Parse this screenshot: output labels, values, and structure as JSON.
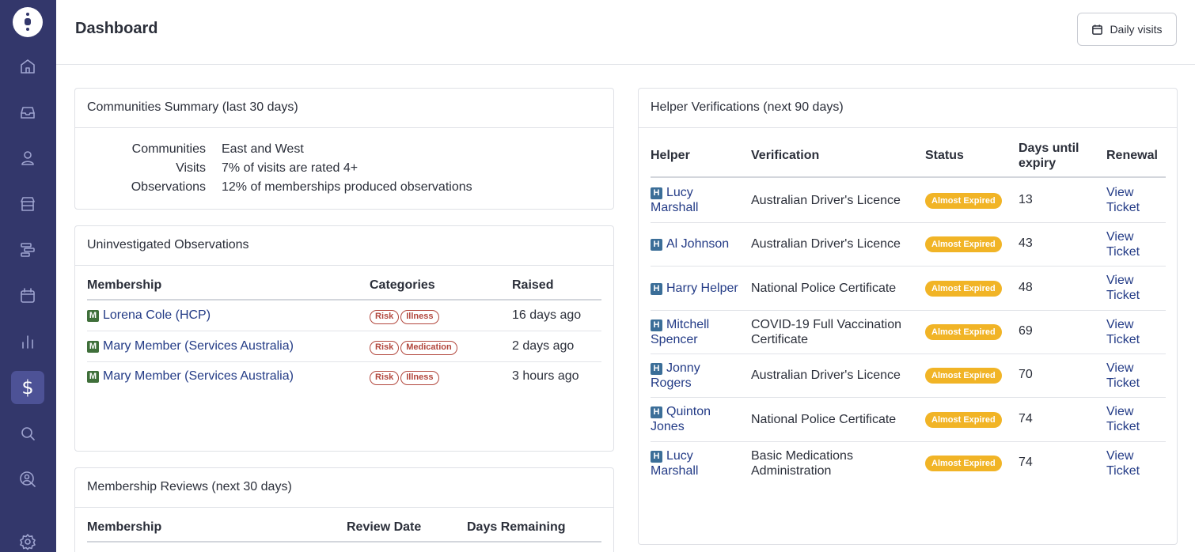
{
  "page": {
    "title": "Dashboard"
  },
  "header": {
    "daily_visits_label": "Daily visits"
  },
  "communities_summary": {
    "title": "Communities Summary (last 30 days)",
    "rows": [
      {
        "label": "Communities",
        "value": "East and West"
      },
      {
        "label": "Visits",
        "value": "7% of visits are rated 4+"
      },
      {
        "label": "Observations",
        "value": "12% of memberships produced observations"
      }
    ]
  },
  "uninvestigated": {
    "title": "Uninvestigated Observations",
    "columns": [
      "Membership",
      "Categories",
      "Raised"
    ],
    "badge": "M",
    "rows": [
      {
        "membership": "Lorena Cole (HCP)",
        "tags": [
          "Risk",
          "Illness"
        ],
        "raised": "16 days ago"
      },
      {
        "membership": "Mary Member (Services Australia)",
        "tags": [
          "Risk",
          "Medication"
        ],
        "raised": "2 days ago"
      },
      {
        "membership": "Mary Member (Services Australia)",
        "tags": [
          "Risk",
          "Illness"
        ],
        "raised": "3 hours ago"
      }
    ]
  },
  "reviews": {
    "title": "Membership Reviews (next 30 days)",
    "columns": [
      "Membership",
      "Review Date",
      "Days Remaining"
    ]
  },
  "verifications": {
    "title": "Helper Verifications (next 90 days)",
    "columns": [
      "Helper",
      "Verification",
      "Status",
      "Days until expiry",
      "Renewal"
    ],
    "badge": "H",
    "rows": [
      {
        "helper": "Lucy Marshall",
        "verification": "Australian Driver's Licence",
        "status": "Almost Expired",
        "days": "13",
        "renewal": "View Ticket"
      },
      {
        "helper": "Al Johnson",
        "verification": "Australian Driver's Licence",
        "status": "Almost Expired",
        "days": "43",
        "renewal": "View Ticket"
      },
      {
        "helper": "Harry Helper",
        "verification": "National Police Certificate",
        "status": "Almost Expired",
        "days": "48",
        "renewal": "View Ticket"
      },
      {
        "helper": "Mitchell Spencer",
        "verification": "COVID-19 Full Vaccination Certificate",
        "status": "Almost Expired",
        "days": "69",
        "renewal": "View Ticket"
      },
      {
        "helper": "Jonny Rogers",
        "verification": "Australian Driver's Licence",
        "status": "Almost Expired",
        "days": "70",
        "renewal": "View Ticket"
      },
      {
        "helper": "Quinton Jones",
        "verification": "National Police Certificate",
        "status": "Almost Expired",
        "days": "74",
        "renewal": "View Ticket"
      },
      {
        "helper": "Lucy Marshall",
        "verification": "Basic Medications Administration",
        "status": "Almost Expired",
        "days": "74",
        "renewal": "View Ticket"
      }
    ]
  },
  "sidebar": {
    "items": [
      "home-icon",
      "inbox-icon",
      "user-icon",
      "store-icon",
      "timeline-icon",
      "calendar-icon",
      "bar-chart-icon",
      "dollar-icon",
      "search-icon",
      "user-search-icon",
      "settings-icon"
    ],
    "active": "dollar-icon",
    "dollar_glyph": "$"
  },
  "colors": {
    "sidebar": "#33376b",
    "status_badge": "#f1b426",
    "tag": "#b2473d",
    "link": "#233b86"
  }
}
